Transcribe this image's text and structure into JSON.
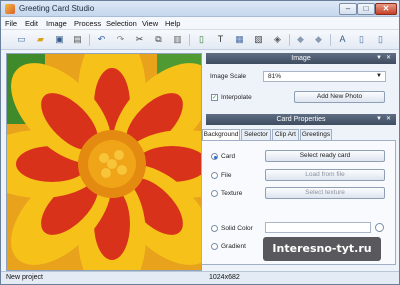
{
  "window": {
    "title": "Greeting Card Studio",
    "controls": {
      "minimize": "–",
      "maximize": "□",
      "close": "✕"
    }
  },
  "menu": [
    "File",
    "Edit",
    "Image",
    "Process",
    "Selection",
    "View",
    "Help"
  ],
  "toolbar": {
    "buttons": [
      {
        "name": "new-icon",
        "glyph": "▭",
        "color": "#4a6fa5"
      },
      {
        "name": "open-icon",
        "glyph": "▰",
        "color": "#d9a21b"
      },
      {
        "name": "save-icon",
        "glyph": "▣",
        "color": "#345a8a"
      },
      {
        "name": "print-icon",
        "glyph": "▤",
        "color": "#555555"
      },
      {
        "name": "undo-icon",
        "glyph": "↶",
        "color": "#2f5fa8"
      },
      {
        "name": "redo-icon",
        "glyph": "↷",
        "color": "#888888"
      },
      {
        "name": "cut-icon",
        "glyph": "✂",
        "color": "#333333"
      },
      {
        "name": "copy-icon",
        "glyph": "⧉",
        "color": "#444444"
      },
      {
        "name": "paste-icon",
        "glyph": "▥",
        "color": "#666666"
      },
      {
        "name": "document-icon",
        "glyph": "▯",
        "color": "#3a7a3a"
      },
      {
        "name": "text-icon",
        "glyph": "T",
        "color": "#333333"
      },
      {
        "name": "image-icon",
        "glyph": "▦",
        "color": "#4a6fa5"
      },
      {
        "name": "frame-icon",
        "glyph": "▧",
        "color": "#444444"
      },
      {
        "name": "effects-icon",
        "glyph": "◈",
        "color": "#555555"
      },
      {
        "name": "move-up-icon",
        "glyph": "◆",
        "color": "#8a9ab0"
      },
      {
        "name": "move-down-icon",
        "glyph": "◆",
        "color": "#8a9ab0"
      },
      {
        "name": "font-icon",
        "glyph": "A",
        "color": "#3a5a8a"
      },
      {
        "name": "page-icon",
        "glyph": "▯",
        "color": "#4a6fa5"
      },
      {
        "name": "export-icon",
        "glyph": "▯",
        "color": "#4a6fa5"
      }
    ]
  },
  "image_panel": {
    "header": "Image",
    "scale_label": "Image Scale",
    "scale_value": "81%",
    "interpolate_label": "Interpolate",
    "interpolate_checked": true,
    "add_photo_button": "Add New Photo"
  },
  "card_panel": {
    "header": "Card Properties",
    "tabs": [
      "Background",
      "Selector",
      "Clip Art",
      "Greetings"
    ],
    "options": {
      "card_label": "Card",
      "select_card_button": "Select ready card",
      "file_label": "File",
      "load_file_button": "Load from file",
      "texture_label": "Texture",
      "select_texture_button": "Select texture",
      "solid_color_label": "Solid Color",
      "gradient_label": "Gradient"
    }
  },
  "status": {
    "project": "New project",
    "dimensions": "1024x682"
  },
  "watermark": "Interesno-tyt.ru",
  "colors": {
    "panel_header": "#4a5870",
    "petal_red": "#d8321a",
    "petal_yellow": "#f6c21a",
    "center_orange": "#e48a10",
    "leaf_green": "#3f8a2a"
  }
}
